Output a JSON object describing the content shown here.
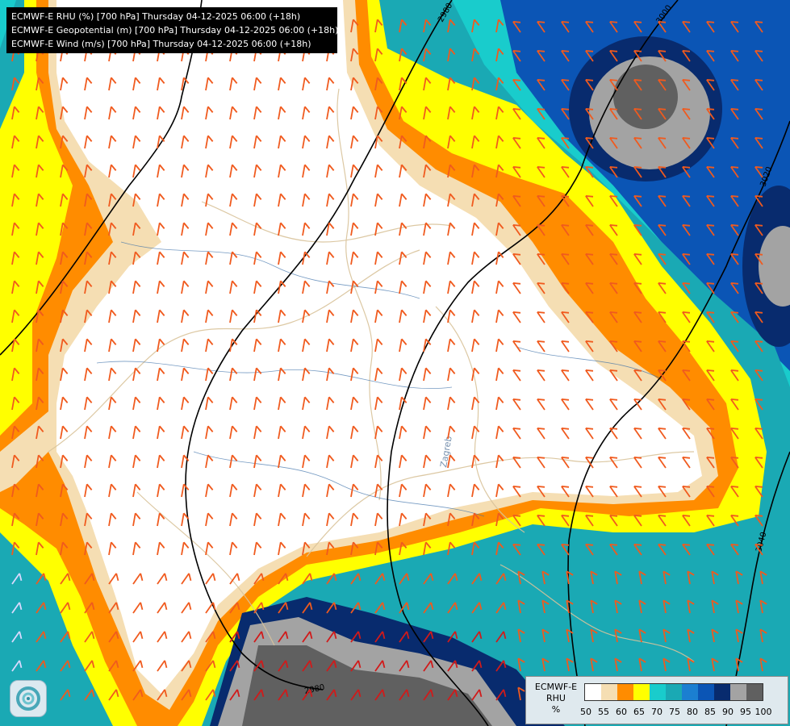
{
  "header": {
    "lines": [
      "ECMWF-E RHU (%) [700 hPa] Thursday 04-12-2025 06:00 (+18h)",
      "ECMWF-E Geopotential (m) [700 hPa] Thursday 04-12-2025 06:00 (+18h)",
      "ECMWF-E Wind (m/s) [700 hPa] Thursday 04-12-2025 06:00 (+18h)"
    ]
  },
  "legend": {
    "title_line1": "ECMWF-E",
    "title_line2": "RHU",
    "unit": "%",
    "ticks": [
      "50",
      "55",
      "60",
      "65",
      "70",
      "75",
      "80",
      "85",
      "90",
      "95",
      "100"
    ],
    "colors": [
      "#ffffff",
      "#f5deb3",
      "#ff8c00",
      "#ffff00",
      "#19cccc",
      "#1aa9b4",
      "#1b7fd1",
      "#0b55b5",
      "#082b6e",
      "#a3a3a3",
      "#606060"
    ]
  },
  "contours": {
    "labels": [
      "2980",
      "3000",
      "3020",
      "3040",
      "2980"
    ]
  },
  "map": {
    "overlay_label": "Zagreb"
  },
  "icons": {
    "logo": "swirl-logo-icon"
  }
}
